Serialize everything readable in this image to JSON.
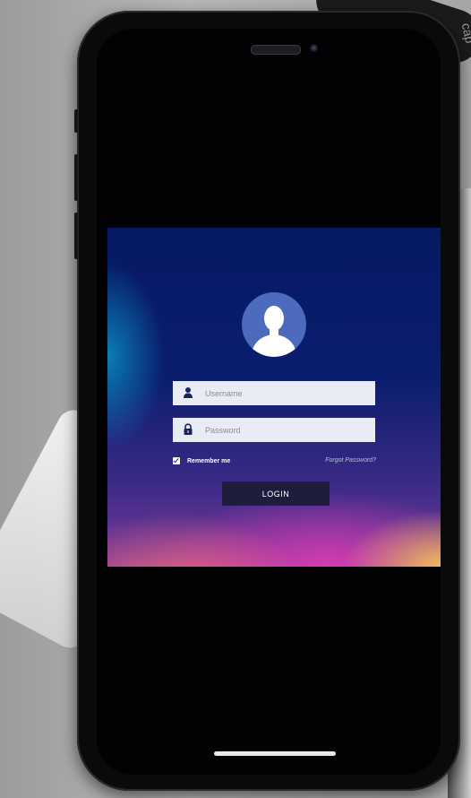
{
  "login": {
    "username_placeholder": "Username",
    "password_placeholder": "Password",
    "remember_label": "Remember me",
    "remember_checked": true,
    "forgot_label": "Forgot Password?",
    "login_label": "LOGIN"
  },
  "background": {
    "partial_text": "cap"
  },
  "colors": {
    "card_top": "#061964",
    "avatar_circle": "#4c6bbc",
    "button_bg": "#1e1d3c"
  }
}
